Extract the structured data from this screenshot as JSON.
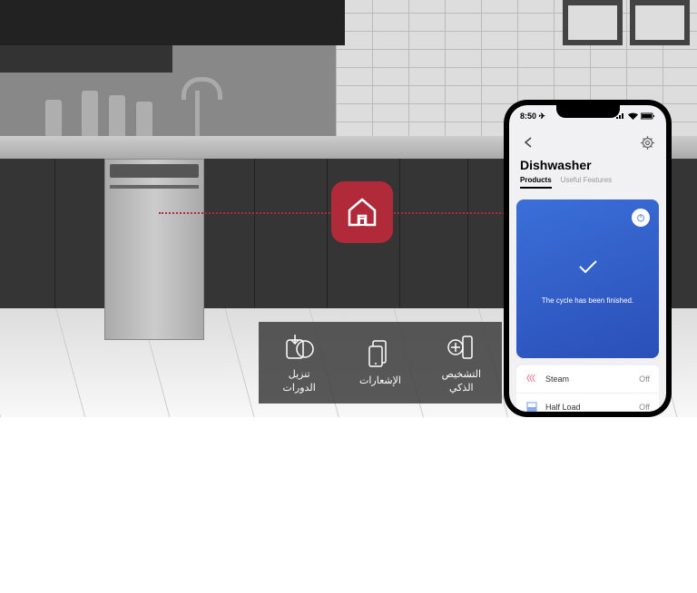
{
  "scene": {
    "home_app_color": "#b02a3a"
  },
  "features": {
    "cycle_download": {
      "label": "تنزيل\nالدورات"
    },
    "notifications": {
      "label": "الإشعارات"
    },
    "smart_diagnosis": {
      "label": "التشخيص\nالذكي"
    }
  },
  "phone": {
    "status_bar": {
      "time": "8:50 ✈"
    },
    "header": {
      "title": "Dishwasher"
    },
    "tabs": {
      "products": "Products",
      "useful_features": "Useful Features"
    },
    "status_card": {
      "message": "The cycle has been finished."
    },
    "options": {
      "steam": {
        "label": "Steam",
        "value": "Off"
      },
      "half_load": {
        "label": "Half Load",
        "value": "Off"
      }
    }
  }
}
